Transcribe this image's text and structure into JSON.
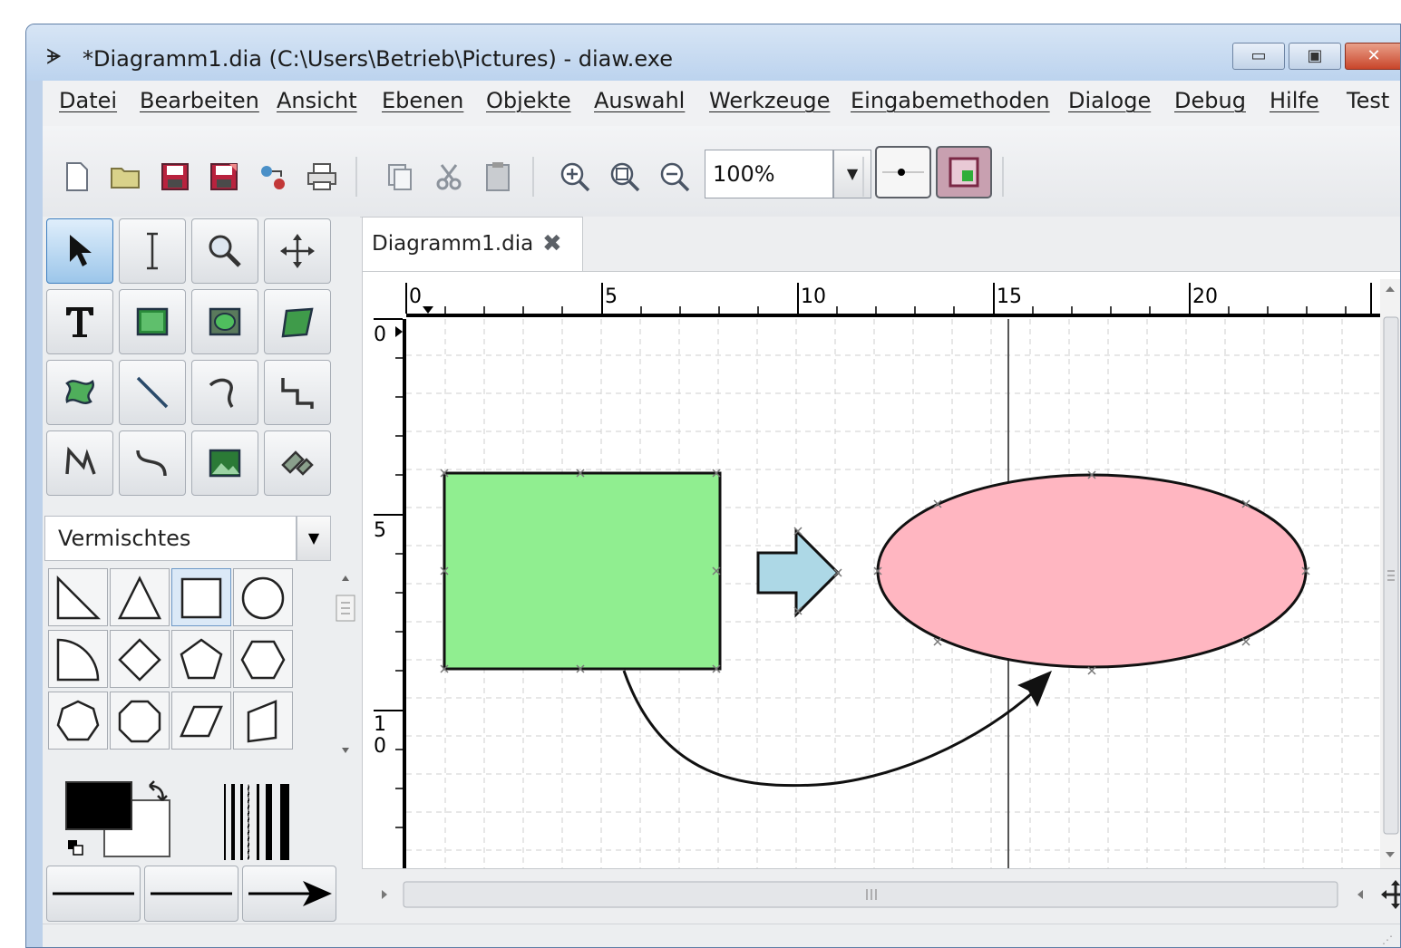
{
  "window": {
    "title": "*Diagramm1.dia (C:\\Users\\Betrieb\\Pictures) - diaw.exe",
    "app_icon": "dia-logo-icon",
    "controls": {
      "minimize": "▭",
      "maximize": "▣",
      "close": "✕"
    }
  },
  "menu": [
    "Datei",
    "Bearbeiten",
    "Ansicht",
    "Ebenen",
    "Objekte",
    "Auswahl",
    "Werkzeuge",
    "Eingabemethoden",
    "Dialoge",
    "Debug",
    "Hilfe",
    "Test"
  ],
  "toolbar": {
    "buttons": [
      "new-icon",
      "open-icon",
      "save-icon",
      "save-as-icon",
      "export-icon",
      "print-icon",
      "copy-icon",
      "cut-icon",
      "paste-icon",
      "zoom-in-icon",
      "zoom-fit-icon",
      "zoom-out-icon"
    ],
    "zoom": "100%"
  },
  "toolbox": {
    "tools": [
      "pointer-icon",
      "text-edit-icon",
      "magnify-icon",
      "scroll-icon",
      "text-tool-icon",
      "box-icon",
      "ellipse-icon",
      "polygon-icon",
      "beziergon-icon",
      "line-icon",
      "arc-icon",
      "zigzag-icon",
      "polyline-icon",
      "bezier-icon",
      "image-icon",
      "outline-icon"
    ],
    "sheet": "Vermischtes",
    "shapes": [
      "right-triangle-icon",
      "triangle-icon",
      "square-icon",
      "circle-icon",
      "quarter-circle-icon",
      "diamond-icon",
      "pentagon-icon",
      "hexagon-icon",
      "heptagon-icon",
      "octagon-icon",
      "parallelogram-icon",
      "trapezoid-icon"
    ],
    "foreground_color": "#000000",
    "background_color": "#ffffff"
  },
  "document": {
    "tab_label": "Diagramm1.dia",
    "zoom": "100%",
    "ruler_h": [
      "0",
      "5",
      "10",
      "15",
      "20"
    ],
    "ruler_v": [
      "0",
      "5",
      "1",
      "0"
    ],
    "shapes": [
      {
        "kind": "rectangle",
        "fill": "#90ee90"
      },
      {
        "kind": "arrow",
        "fill": "#add8e6"
      },
      {
        "kind": "ellipse",
        "fill": "#ffb6c1"
      },
      {
        "kind": "curved-connector",
        "color": "#000000"
      }
    ]
  }
}
